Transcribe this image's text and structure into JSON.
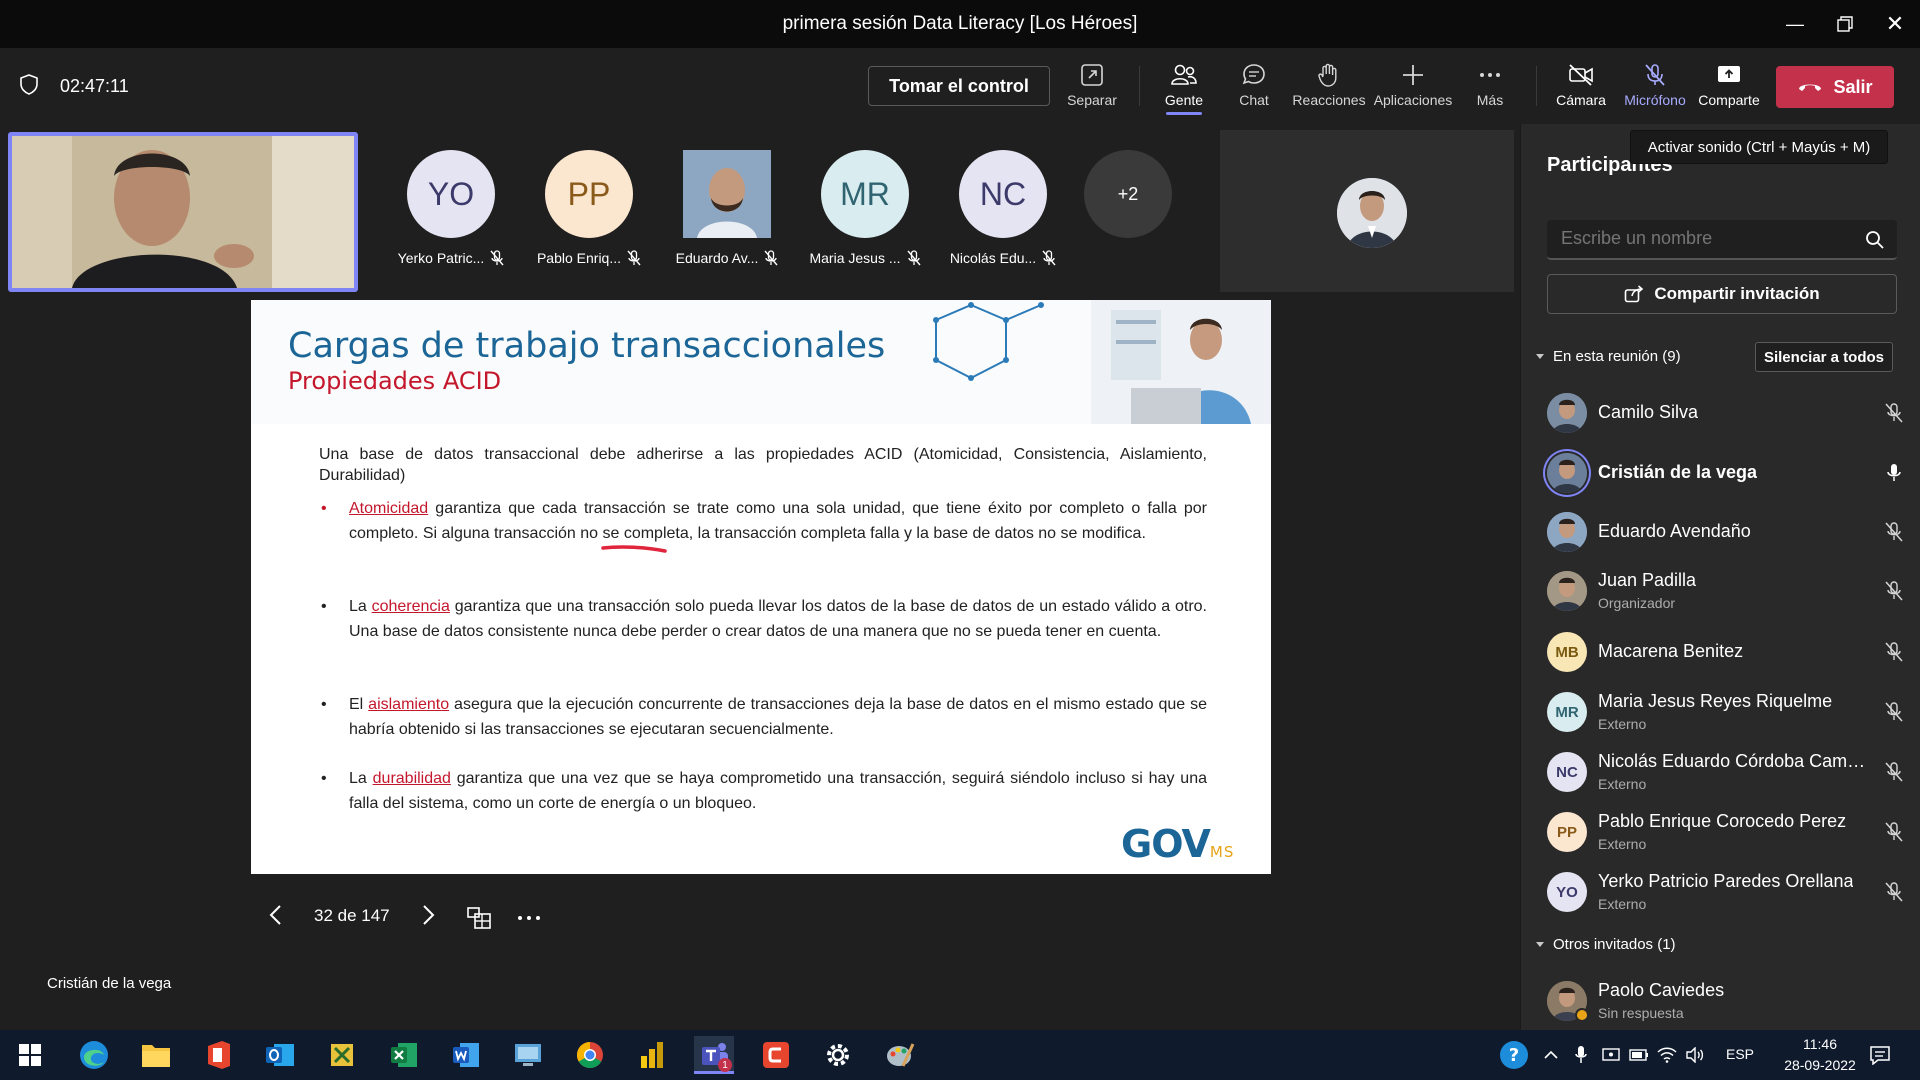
{
  "window": {
    "title": "primera sesión Data Literacy [Los Héroes]"
  },
  "meeting": {
    "timer": "02:47:11",
    "take_control_label": "Tomar el control",
    "toolbar": {
      "separar": "Separar",
      "gente": "Gente",
      "chat": "Chat",
      "reacciones": "Reacciones",
      "aplicaciones": "Aplicaciones",
      "mas": "Más",
      "camara": "Cámara",
      "microfono": "Micrófono",
      "comparte": "Comparte",
      "salir": "Salir"
    },
    "tooltip": "Activar sonido (Ctrl + Mayús + M)",
    "tiles": [
      {
        "initials": "YO",
        "name": "Yerko Patric...",
        "bg": "#e5e4f2",
        "fg": "#3b3a6a"
      },
      {
        "initials": "PP",
        "name": "Pablo Enriq...",
        "bg": "#fbe6cf",
        "fg": "#8a5a1a"
      },
      {
        "initials": "",
        "name": "Eduardo Av...",
        "bg": "#8da7c3",
        "fg": "#fff"
      },
      {
        "initials": "MR",
        "name": "Maria Jesus ...",
        "bg": "#d9ecf0",
        "fg": "#2f6470"
      },
      {
        "initials": "NC",
        "name": "Nicolás Edu...",
        "bg": "#e5e4f2",
        "fg": "#3b3a6a"
      }
    ],
    "more_count": "+2",
    "speaker_name": "Cristián de la vega"
  },
  "slide": {
    "title": "Cargas de trabajo transaccionales",
    "subtitle": "Propiedades ACID",
    "intro": "Una base de datos transaccional debe adherirse a las propiedades ACID (Atomicidad, Consistencia, Aislamiento, Durabilidad)",
    "bullets": [
      {
        "prefix": "",
        "term": "Atomicidad",
        "text": " garantiza que cada transacción se trate como una sola unidad, que tiene éxito por completo o falla por completo. Si alguna transacción no se completa, la transacción completa falla y la base de datos no se modifica."
      },
      {
        "prefix": "La ",
        "term": "coherencia",
        "text": " garantiza que una transacción solo pueda llevar los datos de la base de datos de un estado válido a otro. Una base de datos consistente nunca debe perder o crear datos de una manera que no se pueda tener en cuenta."
      },
      {
        "prefix": "El ",
        "term": "aislamiento",
        "text": " asegura que la ejecución concurrente de transacciones deja la base de datos en el mismo estado que se habría obtenido si las transacciones se ejecutaran secuencialmente."
      },
      {
        "prefix": "La ",
        "term": "durabilidad",
        "text": " garantiza que una vez que se haya comprometido una transacción, seguirá siéndolo incluso si hay una falla del sistema, como un corte de energía o un bloqueo."
      }
    ],
    "logo": "GOV",
    "logo_suffix": "MS",
    "page_indicator": "32 de 147"
  },
  "participants": {
    "title": "Participantes",
    "search_placeholder": "Escribe un nombre",
    "share_label": "Compartir invitación",
    "in_meeting_label": "En esta reunión (9)",
    "mute_all_label": "Silenciar a todos",
    "list": [
      {
        "name": "Camilo Silva",
        "sub": "",
        "initials": "",
        "bg": "#7b8da3",
        "fg": "#fff",
        "mic": "muted"
      },
      {
        "name": "Cristián de la vega",
        "sub": "",
        "initials": "",
        "bg": "#6b7f9a",
        "fg": "#fff",
        "mic": "on",
        "bold": true
      },
      {
        "name": "Eduardo Avendaño",
        "sub": "",
        "initials": "",
        "bg": "#8da7c3",
        "fg": "#fff",
        "mic": "muted"
      },
      {
        "name": "Juan Padilla",
        "sub": "Organizador",
        "initials": "",
        "bg": "#a39785",
        "fg": "#fff",
        "mic": "muted"
      },
      {
        "name": "Macarena Benitez",
        "sub": "",
        "initials": "MB",
        "bg": "#f8e7b5",
        "fg": "#7a5a10",
        "mic": "muted"
      },
      {
        "name": "Maria Jesus Reyes Riquelme",
        "sub": "Externo",
        "initials": "MR",
        "bg": "#d9ecf0",
        "fg": "#2f6470",
        "mic": "muted"
      },
      {
        "name": "Nicolás Eduardo Córdoba Campos",
        "sub": "Externo",
        "initials": "NC",
        "bg": "#e5e4f2",
        "fg": "#3b3a6a",
        "mic": "muted"
      },
      {
        "name": "Pablo Enrique Corocedo Perez",
        "sub": "Externo",
        "initials": "PP",
        "bg": "#fbe6cf",
        "fg": "#8a5a1a",
        "mic": "muted"
      },
      {
        "name": "Yerko Patricio Paredes Orellana",
        "sub": "Externo",
        "initials": "YO",
        "bg": "#e5e4f2",
        "fg": "#3b3a6a",
        "mic": "muted"
      }
    ],
    "others_label": "Otros invitados (1)",
    "others": [
      {
        "name": "Paolo Caviedes",
        "sub": "Sin respuesta",
        "bg": "#8a7a66"
      }
    ]
  },
  "taskbar": {
    "language": "ESP",
    "time": "11:46",
    "date": "28-09-2022",
    "teams_badge": "1"
  }
}
